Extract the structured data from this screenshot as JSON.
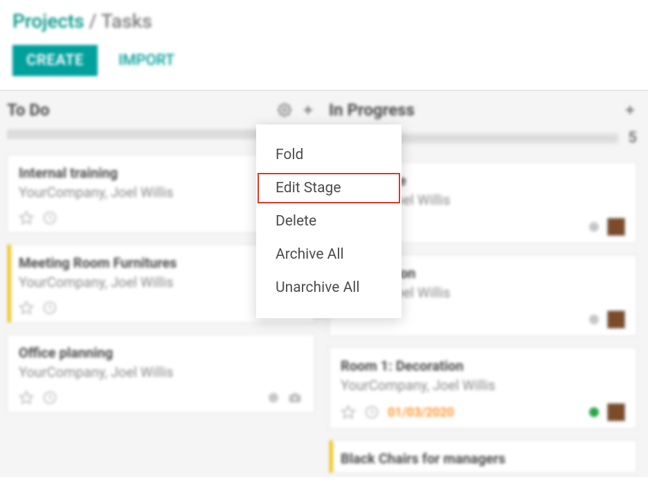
{
  "breadcrumbs": {
    "parent": "Projects",
    "sep": "/",
    "current": "Tasks"
  },
  "actions": {
    "create": "CREATE",
    "import": "IMPORT"
  },
  "columns": [
    {
      "title": "To Do",
      "cards": [
        {
          "title": "Internal training",
          "sub": "YourCompany, Joel Willis",
          "accent": false,
          "due": "",
          "dot": "grey",
          "avatar": false
        },
        {
          "title": "Meeting Room Furnitures",
          "sub": "YourCompany, Joel Willis",
          "accent": true,
          "due": "",
          "dot": "grey",
          "avatar": false
        },
        {
          "title": "Office planning",
          "sub": "YourCompany, Joel Willis",
          "accent": false,
          "due": "",
          "dot": "grey",
          "avatar": false
        }
      ]
    },
    {
      "title": "In Progress",
      "count": "5",
      "cards": [
        {
          "title": "Certificate",
          "sub": "mpany, Joel Willis",
          "accent": false,
          "due": "",
          "dot": "grey",
          "avatar": true
        },
        {
          "title": ": Decoration",
          "sub": "mpany, Joel Willis",
          "accent": false,
          "due": "",
          "dot": "grey",
          "avatar": true
        },
        {
          "title": "Room 1: Decoration",
          "sub": "YourCompany, Joel Willis",
          "accent": false,
          "due": "01/03/2020",
          "dot": "green",
          "avatar": true
        },
        {
          "title": "Black Chairs for managers",
          "sub": "",
          "accent": true,
          "due": "",
          "dot": "",
          "avatar": false
        }
      ]
    }
  ],
  "menu": {
    "fold": "Fold",
    "edit": "Edit Stage",
    "delete": "Delete",
    "archive": "Archive All",
    "unarchive": "Unarchive All"
  }
}
